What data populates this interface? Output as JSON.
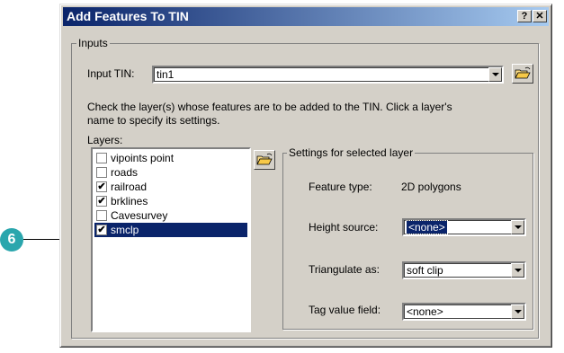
{
  "dialog": {
    "title": "Add Features To TIN",
    "help_button": "?",
    "close_button": "✕"
  },
  "callout": {
    "number": "6"
  },
  "inputs_group": {
    "legend": "Inputs",
    "input_tin_label": "Input TIN:",
    "input_tin_value": "tin1",
    "instructions": [
      "Check the layer(s) whose features are to be added to the TIN. Click a layer's",
      "name to specify its settings."
    ],
    "layers_label": "Layers:",
    "layers": [
      {
        "label": "vipoints point",
        "checked": false
      },
      {
        "label": "roads",
        "checked": false
      },
      {
        "label": "railroad",
        "checked": true
      },
      {
        "label": "brklines",
        "checked": true
      },
      {
        "label": "Cavesurvey",
        "checked": false
      },
      {
        "label": "smclp",
        "checked": true,
        "selected": true
      }
    ]
  },
  "settings_group": {
    "legend": "Settings for selected layer",
    "feature_type_label": "Feature type:",
    "feature_type_value": "2D polygons",
    "height_source_label": "Height source:",
    "height_source_value": "<none>",
    "triangulate_as_label": "Triangulate as:",
    "triangulate_as_value": "soft clip",
    "tag_value_field_label": "Tag value field:",
    "tag_value_field_value": "<none>"
  },
  "icons": {
    "open_folder": "folder-open-icon",
    "dropdown": "chevron-down-icon",
    "checkmark": "✔"
  },
  "colors": {
    "title_start": "#0a246a",
    "title_end": "#a6caf0",
    "face": "#d4d0c8",
    "selection": "#0a246a",
    "callout": "#2aa6ad"
  }
}
